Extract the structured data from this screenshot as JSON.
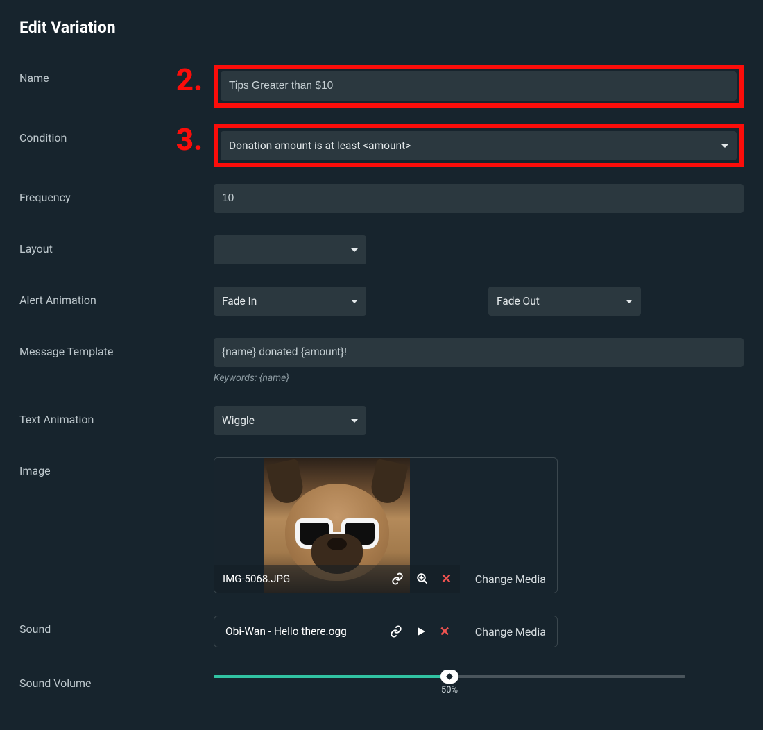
{
  "title": "Edit Variation",
  "callouts": {
    "two": "2.",
    "three": "3."
  },
  "labels": {
    "name": "Name",
    "condition": "Condition",
    "frequency": "Frequency",
    "layout": "Layout",
    "alert_animation": "Alert Animation",
    "message_template": "Message Template",
    "text_animation": "Text Animation",
    "image": "Image",
    "sound": "Sound",
    "sound_volume": "Sound Volume"
  },
  "fields": {
    "name_value": "Tips Greater than $10",
    "condition_value": "Donation amount is at least <amount>",
    "frequency_value": "10",
    "layout_value": "",
    "anim_in": "Fade In",
    "anim_out": "Fade Out",
    "message_template_value": "{name} donated {amount}!",
    "keywords_hint": "Keywords: {name}",
    "text_animation_value": "Wiggle"
  },
  "image": {
    "filename": "IMG-5068.JPG",
    "change_label": "Change Media"
  },
  "sound": {
    "filename": "Obi-Wan - Hello there.ogg",
    "change_label": "Change Media"
  },
  "volume": {
    "percent": 50,
    "display": "50%"
  }
}
